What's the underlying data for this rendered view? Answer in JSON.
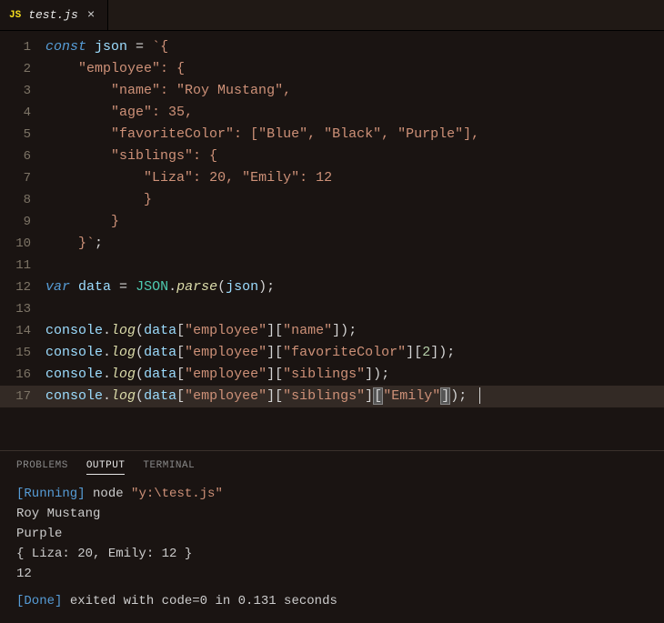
{
  "tab": {
    "icon_label": "JS",
    "filename": "test.js"
  },
  "lines": [
    {
      "n": "1"
    },
    {
      "n": "2"
    },
    {
      "n": "3"
    },
    {
      "n": "4"
    },
    {
      "n": "5"
    },
    {
      "n": "6"
    },
    {
      "n": "7"
    },
    {
      "n": "8"
    },
    {
      "n": "9"
    },
    {
      "n": "10"
    },
    {
      "n": "11"
    },
    {
      "n": "12"
    },
    {
      "n": "13"
    },
    {
      "n": "14"
    },
    {
      "n": "15"
    },
    {
      "n": "16"
    },
    {
      "n": "17"
    }
  ],
  "code": {
    "l1": {
      "const": "const",
      "json": "json",
      "eq": " = ",
      "tick": "`",
      "brace": "{"
    },
    "l2": {
      "prop": "\"employee\"",
      "colon": ": ",
      "brace": "{"
    },
    "l3": {
      "prop": "\"name\"",
      "colon": ": ",
      "val": "\"Roy Mustang\"",
      "comma": ","
    },
    "l4": {
      "prop": "\"age\"",
      "colon": ": ",
      "val": "35",
      "comma": ","
    },
    "l5": {
      "prop": "\"favoriteColor\"",
      "colon": ": ",
      "lb": "[",
      "v1": "\"Blue\"",
      "c1": ", ",
      "v2": "\"Black\"",
      "c2": ", ",
      "v3": "\"Purple\"",
      "rb": "]",
      "comma": ","
    },
    "l6": {
      "prop": "\"siblings\"",
      "colon": ": ",
      "brace": "{"
    },
    "l7": {
      "p1": "\"Liza\"",
      "c1": ": ",
      "v1": "20",
      "comma": ", ",
      "p2": "\"Emily\"",
      "c2": ": ",
      "v2": "12"
    },
    "l8": {
      "brace": "}"
    },
    "l9": {
      "brace": "}"
    },
    "l10": {
      "brace": "}",
      "tick": "`",
      ";": ";"
    },
    "l12": {
      "var": "var",
      "data": "data",
      "eq": " = ",
      "json_obj": "JSON",
      "dot": ".",
      "parse": "parse",
      "lp": "(",
      "arg": "json",
      "rp": ")",
      ";": ";"
    },
    "l14": {
      "console": "console",
      "dot": ".",
      "log": "log",
      "lp": "(",
      "data": "data",
      "b1": "[",
      "k1": "\"employee\"",
      "b2": "]",
      "b3": "[",
      "k2": "\"name\"",
      "b4": "]",
      "rp": ")",
      ";": ";"
    },
    "l15": {
      "console": "console",
      "dot": ".",
      "log": "log",
      "lp": "(",
      "data": "data",
      "b1": "[",
      "k1": "\"employee\"",
      "b2": "]",
      "b3": "[",
      "k2": "\"favoriteColor\"",
      "b4": "]",
      "b5": "[",
      "idx": "2",
      "b6": "]",
      "rp": ")",
      ";": ";"
    },
    "l16": {
      "console": "console",
      "dot": ".",
      "log": "log",
      "lp": "(",
      "data": "data",
      "b1": "[",
      "k1": "\"employee\"",
      "b2": "]",
      "b3": "[",
      "k2": "\"siblings\"",
      "b4": "]",
      "rp": ")",
      ";": ";"
    },
    "l17": {
      "console": "console",
      "dot": ".",
      "log": "log",
      "lp": "(",
      "data": "data",
      "b1": "[",
      "k1": "\"employee\"",
      "b2": "]",
      "b3": "[",
      "k2": "\"siblings\"",
      "b4": "]",
      "b5": "[",
      "k3": "\"Emily\"",
      "b6": "]",
      "rp": ")",
      ";": ";"
    }
  },
  "panel": {
    "tabs": {
      "problems": "PROBLEMS",
      "output": "OUTPUT",
      "terminal": "TERMINAL"
    },
    "running_tag": "[Running]",
    "running_cmd": " node ",
    "running_path": "\"y:\\test.js\"",
    "out1": "Roy Mustang",
    "out2": "Purple",
    "out3": "{ Liza: 20, Emily: 12 }",
    "out4": "12",
    "done_tag": "[Done]",
    "done_msg": " exited with code=0 in 0.131 seconds"
  }
}
